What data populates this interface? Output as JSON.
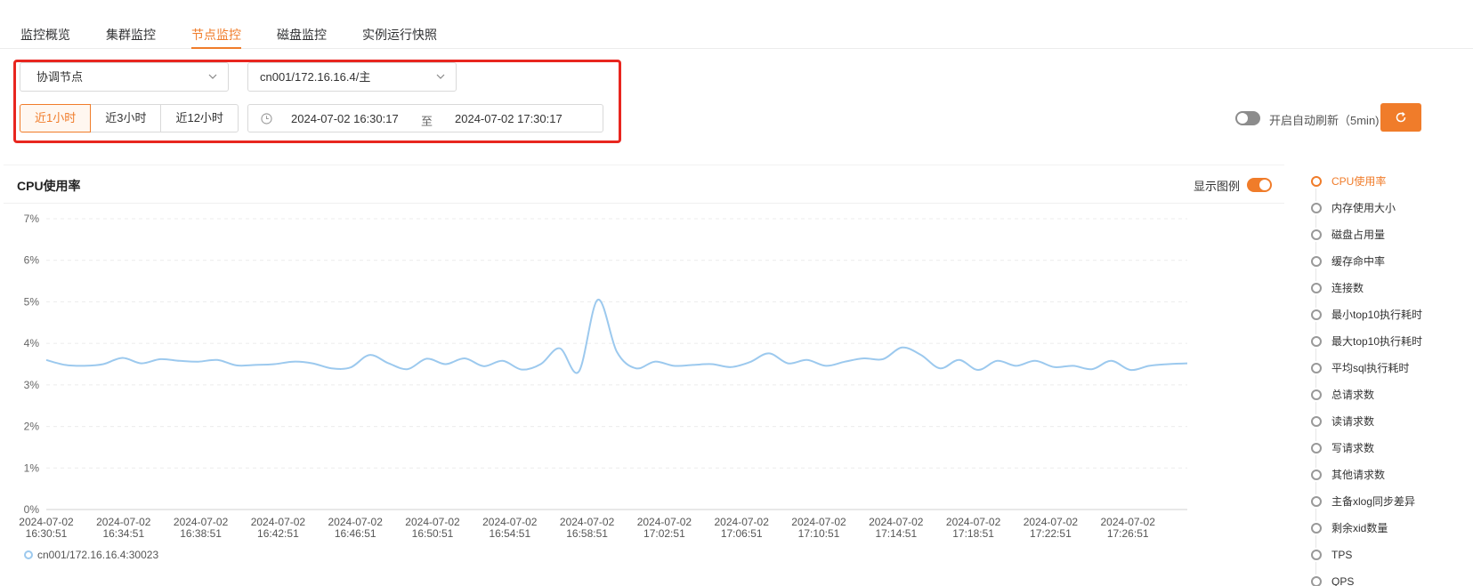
{
  "tabs": [
    {
      "label": "监控概览",
      "active": false
    },
    {
      "label": "集群监控",
      "active": false
    },
    {
      "label": "节点监控",
      "active": true
    },
    {
      "label": "磁盘监控",
      "active": false
    },
    {
      "label": "实例运行快照",
      "active": false
    }
  ],
  "filters": {
    "node_type": "协调节点",
    "node_instance": "cn001/172.16.16.4/主",
    "ranges": [
      {
        "label": "近1小时",
        "active": true
      },
      {
        "label": "近3小时",
        "active": false
      },
      {
        "label": "近12小时",
        "active": false
      }
    ],
    "date_start": "2024-07-02 16:30:17",
    "date_sep": "至",
    "date_end": "2024-07-02 17:30:17"
  },
  "auto_refresh": {
    "label": "开启自动刷新（5min)",
    "enabled": false
  },
  "chart_card": {
    "title": "CPU使用率",
    "legend_label": "显示图例",
    "legend_on": true
  },
  "colors": {
    "accent": "#f07c2a",
    "series": "#9cc9ee",
    "highlight_border": "#e8261f"
  },
  "chart_data": {
    "type": "line",
    "title": "CPU使用率",
    "ylim": [
      0,
      7
    ],
    "y_ticks": [
      "0%",
      "1%",
      "2%",
      "3%",
      "4%",
      "5%",
      "6%",
      "7%"
    ],
    "x_ticks": [
      [
        "2024-07-02",
        "16:30:51"
      ],
      [
        "2024-07-02",
        "16:34:51"
      ],
      [
        "2024-07-02",
        "16:38:51"
      ],
      [
        "2024-07-02",
        "16:42:51"
      ],
      [
        "2024-07-02",
        "16:46:51"
      ],
      [
        "2024-07-02",
        "16:50:51"
      ],
      [
        "2024-07-02",
        "16:54:51"
      ],
      [
        "2024-07-02",
        "16:58:51"
      ],
      [
        "2024-07-02",
        "17:02:51"
      ],
      [
        "2024-07-02",
        "17:06:51"
      ],
      [
        "2024-07-02",
        "17:10:51"
      ],
      [
        "2024-07-02",
        "17:14:51"
      ],
      [
        "2024-07-02",
        "17:18:51"
      ],
      [
        "2024-07-02",
        "17:22:51"
      ],
      [
        "2024-07-02",
        "17:26:51"
      ]
    ],
    "grid": true,
    "series": [
      {
        "name": "cn001/172.16.16.4:30023",
        "values": [
          3.6,
          3.48,
          3.46,
          3.5,
          3.65,
          3.52,
          3.62,
          3.58,
          3.56,
          3.6,
          3.47,
          3.48,
          3.5,
          3.56,
          3.52,
          3.4,
          3.42,
          3.72,
          3.52,
          3.38,
          3.63,
          3.5,
          3.64,
          3.45,
          3.58,
          3.37,
          3.5,
          3.88,
          3.32,
          5.05,
          3.8,
          3.4,
          3.56,
          3.46,
          3.48,
          3.5,
          3.43,
          3.55,
          3.76,
          3.52,
          3.6,
          3.46,
          3.56,
          3.64,
          3.62,
          3.9,
          3.72,
          3.4,
          3.6,
          3.36,
          3.58,
          3.46,
          3.58,
          3.43,
          3.46,
          3.38,
          3.58,
          3.36,
          3.46,
          3.5,
          3.52
        ]
      }
    ]
  },
  "metrics": [
    {
      "label": "CPU使用率",
      "active": true
    },
    {
      "label": "内存使用大小",
      "active": false
    },
    {
      "label": "磁盘占用量",
      "active": false
    },
    {
      "label": "缓存命中率",
      "active": false
    },
    {
      "label": "连接数",
      "active": false
    },
    {
      "label": "最小top10执行耗时",
      "active": false
    },
    {
      "label": "最大top10执行耗时",
      "active": false
    },
    {
      "label": "平均sql执行耗时",
      "active": false
    },
    {
      "label": "总请求数",
      "active": false
    },
    {
      "label": "读请求数",
      "active": false
    },
    {
      "label": "写请求数",
      "active": false
    },
    {
      "label": "其他请求数",
      "active": false
    },
    {
      "label": "主备xlog同步差异",
      "active": false
    },
    {
      "label": "剩余xid数量",
      "active": false
    },
    {
      "label": "TPS",
      "active": false
    },
    {
      "label": "QPS",
      "active": false
    }
  ]
}
